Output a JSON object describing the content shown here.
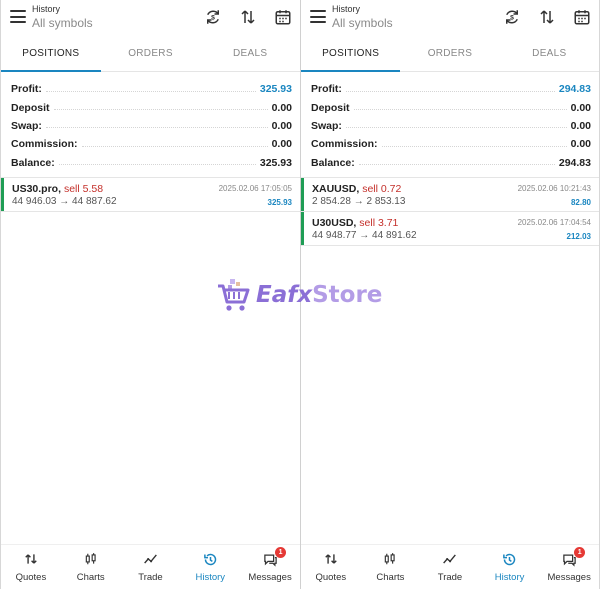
{
  "panes": [
    {
      "header": {
        "title": "History",
        "subtitle": "All symbols"
      },
      "tabs": [
        "POSITIONS",
        "ORDERS",
        "DEALS"
      ],
      "summary": [
        {
          "label": "Profit:",
          "value": "325.93",
          "highlight": true
        },
        {
          "label": "Deposit",
          "value": "0.00",
          "highlight": false
        },
        {
          "label": "Swap:",
          "value": "0.00",
          "highlight": false
        },
        {
          "label": "Commission:",
          "value": "0.00",
          "highlight": false
        },
        {
          "label": "Balance:",
          "value": "325.93",
          "highlight": false
        }
      ],
      "deals": [
        {
          "symbol": "US30.pro,",
          "side": "sell 5.58",
          "prices": "44 946.03 → 44 887.62",
          "time": "2025.02.06 17:05:05",
          "profit": "325.93"
        }
      ]
    },
    {
      "header": {
        "title": "History",
        "subtitle": "All symbols"
      },
      "tabs": [
        "POSITIONS",
        "ORDERS",
        "DEALS"
      ],
      "summary": [
        {
          "label": "Profit:",
          "value": "294.83",
          "highlight": true
        },
        {
          "label": "Deposit",
          "value": "0.00",
          "highlight": false
        },
        {
          "label": "Swap:",
          "value": "0.00",
          "highlight": false
        },
        {
          "label": "Commission:",
          "value": "0.00",
          "highlight": false
        },
        {
          "label": "Balance:",
          "value": "294.83",
          "highlight": false
        }
      ],
      "deals": [
        {
          "symbol": "XAUUSD,",
          "side": "sell 0.72",
          "prices": "2 854.28 → 2 853.13",
          "time": "2025.02.06 10:21:43",
          "profit": "82.80"
        },
        {
          "symbol": "U30USD,",
          "side": "sell 3.71",
          "prices": "44 948.77 → 44 891.62",
          "time": "2025.02.06 17:04:54",
          "profit": "212.03"
        }
      ]
    }
  ],
  "nav": [
    {
      "label": "Quotes",
      "icon": "quotes-icon"
    },
    {
      "label": "Charts",
      "icon": "charts-icon"
    },
    {
      "label": "Trade",
      "icon": "trade-icon"
    },
    {
      "label": "History",
      "icon": "history-icon",
      "active": true
    },
    {
      "label": "Messages",
      "icon": "messages-icon",
      "badge": "1"
    }
  ],
  "header_icons": [
    "currency-exchange-icon",
    "sort-icon",
    "calendar-icon"
  ],
  "watermark": {
    "part1": "Eafx",
    "part2": "Store"
  },
  "colors": {
    "accent": "#1a86c0",
    "sell": "#c4302b",
    "profit_bar": "#1f9d55",
    "badge": "#e53935",
    "watermark": "#8b6fd6"
  }
}
